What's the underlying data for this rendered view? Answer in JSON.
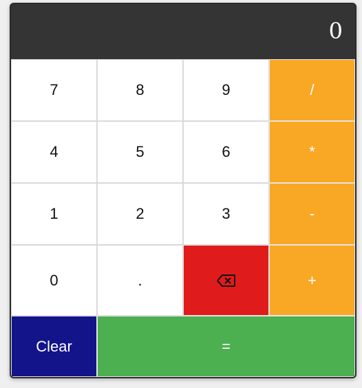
{
  "display": {
    "value": "0"
  },
  "keys": {
    "seven": "7",
    "eight": "8",
    "nine": "9",
    "divide": "/",
    "four": "4",
    "five": "5",
    "six": "6",
    "multiply": "*",
    "one": "1",
    "two": "2",
    "three": "3",
    "subtract": "-",
    "zero": "0",
    "decimal": ".",
    "backspace_icon": "backspace-icon",
    "add": "+",
    "clear": "Clear",
    "equals": "="
  },
  "colors": {
    "display_bg": "#343434",
    "operator": "#f9a825",
    "backspace": "#e01b1b",
    "clear": "#13148a",
    "equals": "#4caf50",
    "number": "#ffffff"
  }
}
